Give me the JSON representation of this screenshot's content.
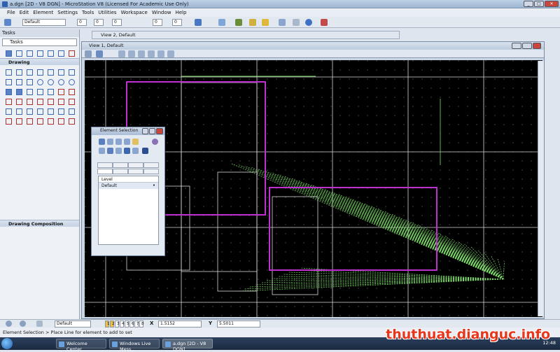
{
  "window": {
    "title": "a.dgn [2D - V8 DGN] - MicroStation V8 (Licensed For Academic Use Only)",
    "min": "_",
    "max": "□",
    "close": "✕"
  },
  "menu": [
    "File",
    "Edit",
    "Element",
    "Settings",
    "Tools",
    "Utilities",
    "Workspace",
    "Window",
    "Help"
  ],
  "toolbar": {
    "level": "Default",
    "weight": "0",
    "style": "0",
    "color": "0",
    "num1": "0",
    "num2": "0",
    "num3": "0"
  },
  "tasks": {
    "title": "Tasks",
    "selected": "Tasks",
    "drawing": "Drawing",
    "composition": "Drawing Composition"
  },
  "views": {
    "view2": "View 2, Default",
    "view1": "View 1, Default"
  },
  "element_selection": {
    "title": "Element Selection",
    "level_header": "Level",
    "level_value": "Default"
  },
  "statusbar": {
    "level": "Default",
    "x_label": "X",
    "x_value": "1.5152",
    "y_label": "Y",
    "y_value": "5.5011",
    "views": [
      "1",
      "2",
      "3",
      "4",
      "5",
      "6",
      "7",
      "8"
    ]
  },
  "status_message": "Element Selection > Place Line for element to add to set",
  "taskbar": {
    "items": [
      "Welcome Center",
      "Windows Live Mess...",
      "a.dgn [2D - V8 DGN]..."
    ],
    "clock": "12:48"
  },
  "watermark": "thuthuat.dianguc.info"
}
